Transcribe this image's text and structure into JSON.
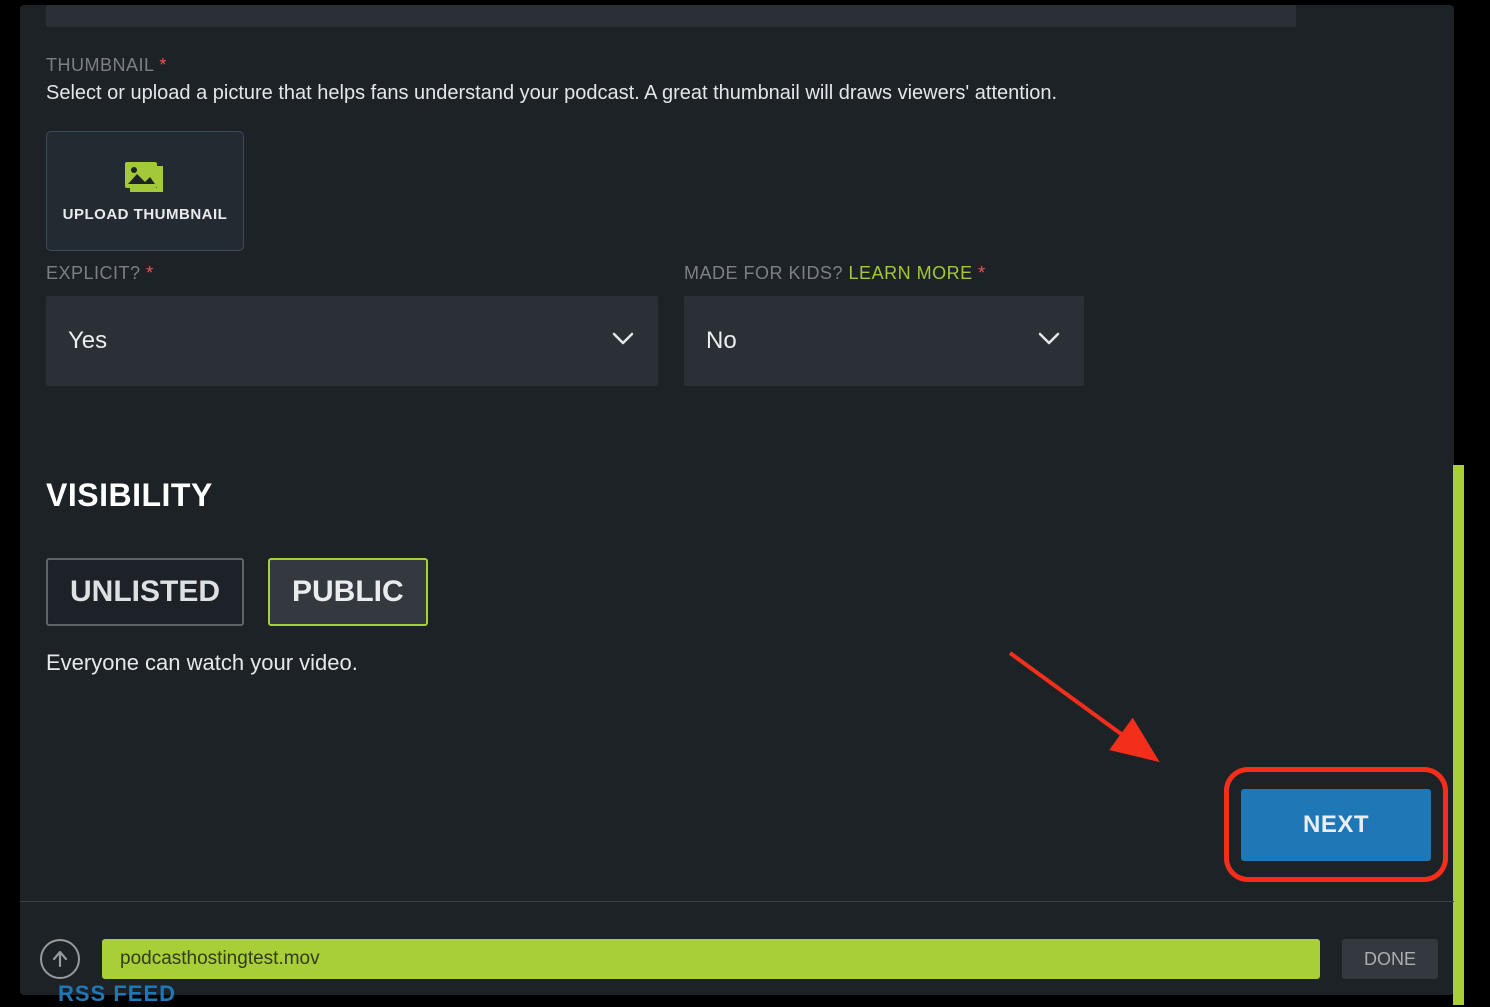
{
  "thumbnail": {
    "label": "THUMBNAIL",
    "description": "Select or upload a picture that helps fans understand your podcast. A great thumbnail will draws viewers' attention.",
    "upload_button": "UPLOAD THUMBNAIL"
  },
  "explicit": {
    "label": "EXPLICIT?",
    "value": "Yes"
  },
  "made_for_kids": {
    "label": "MADE FOR KIDS?",
    "learn_more": "LEARN MORE",
    "value": "No"
  },
  "visibility": {
    "title": "VISIBILITY",
    "options": {
      "unlisted": "UNLISTED",
      "public": "PUBLIC"
    },
    "description": "Everyone can watch your video."
  },
  "buttons": {
    "next": "NEXT",
    "done": "DONE"
  },
  "upload_progress": {
    "filename": "podcasthostingtest.mov"
  },
  "rss_label": "RSS FEED",
  "colors": {
    "background": "#1d2227",
    "accent_green": "#a8cf38",
    "button_blue": "#1f78b6",
    "highlight_red": "#f32f1c"
  }
}
